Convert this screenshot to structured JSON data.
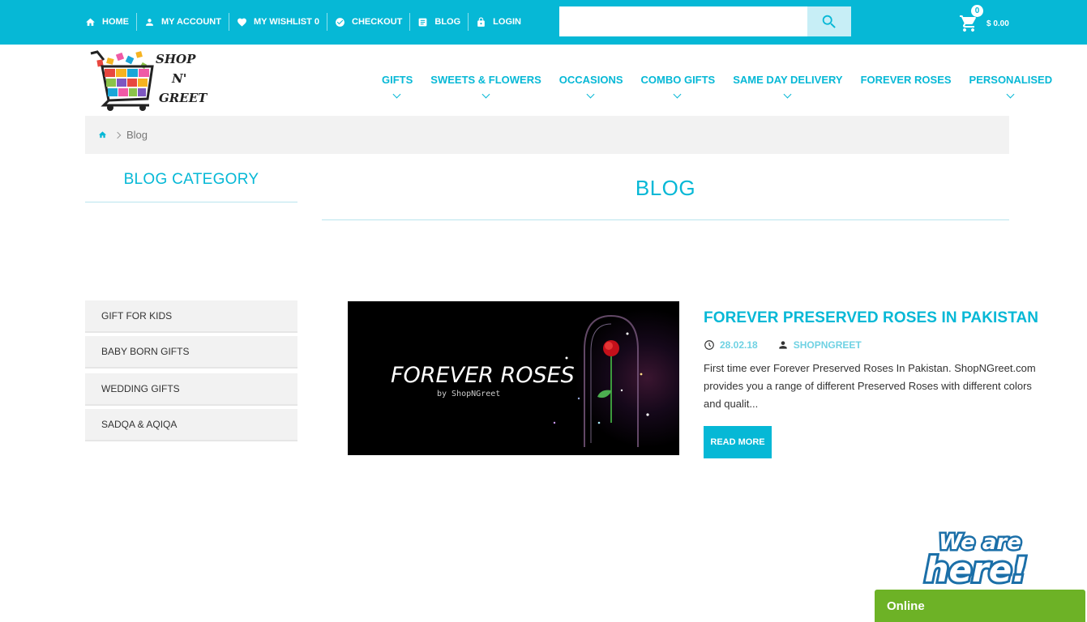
{
  "topbar": {
    "links": [
      {
        "label": "HOME",
        "icon": "home-icon"
      },
      {
        "label": "MY ACCOUNT",
        "icon": "user-icon"
      },
      {
        "label": "MY WISHLIST 0",
        "icon": "heart-icon"
      },
      {
        "label": "CHECKOUT",
        "icon": "check-circle-icon"
      },
      {
        "label": "BLOG",
        "icon": "document-icon"
      },
      {
        "label": "LOGIN",
        "icon": "lock-icon"
      }
    ],
    "search": {
      "placeholder": "",
      "value": "",
      "icon": "search-icon"
    },
    "cart": {
      "count": "0",
      "total": "$ 0.00",
      "icon": "cart-icon"
    }
  },
  "brand": {
    "line1": "SHOP",
    "line2": "N'",
    "line3": "GREET"
  },
  "nav": {
    "items": [
      {
        "label": "GIFTS",
        "has_dropdown": true
      },
      {
        "label": "SWEETS & FLOWERS",
        "has_dropdown": true
      },
      {
        "label": "OCCASIONS",
        "has_dropdown": true
      },
      {
        "label": "COMBO GIFTS",
        "has_dropdown": true
      },
      {
        "label": "SAME DAY DELIVERY",
        "has_dropdown": true
      },
      {
        "label": "FOREVER ROSES",
        "has_dropdown": false
      },
      {
        "label": "PERSONALISED",
        "has_dropdown": true
      }
    ]
  },
  "breadcrumb": {
    "current": "Blog"
  },
  "sidebar": {
    "title": "BLOG CATEGORY",
    "categories": [
      "GIFT FOR KIDS",
      "BABY BORN GIFTS",
      "WEDDING GIFTS",
      "SADQA & AQIQA"
    ]
  },
  "main": {
    "title": "BLOG",
    "post": {
      "image_text": "FOREVER ROSES",
      "image_subtext": "by ShopNGreet",
      "title": "FOREVER PRESERVED ROSES IN PAKISTAN",
      "date": "28.02.18",
      "author": "SHOPNGREET",
      "excerpt": "First time ever Forever Preserved Roses In Pakistan. ShopNGreet.com provides you a range of different Preserved Roses with different colors and qualit...",
      "read_more": "READ MORE"
    }
  },
  "chat": {
    "badge_line1": "We are",
    "badge_line2": "here!",
    "status": "Online"
  },
  "colors": {
    "accent": "#06b8d6",
    "chat_green": "#6db226",
    "panel_gray": "#f2f2f2"
  }
}
